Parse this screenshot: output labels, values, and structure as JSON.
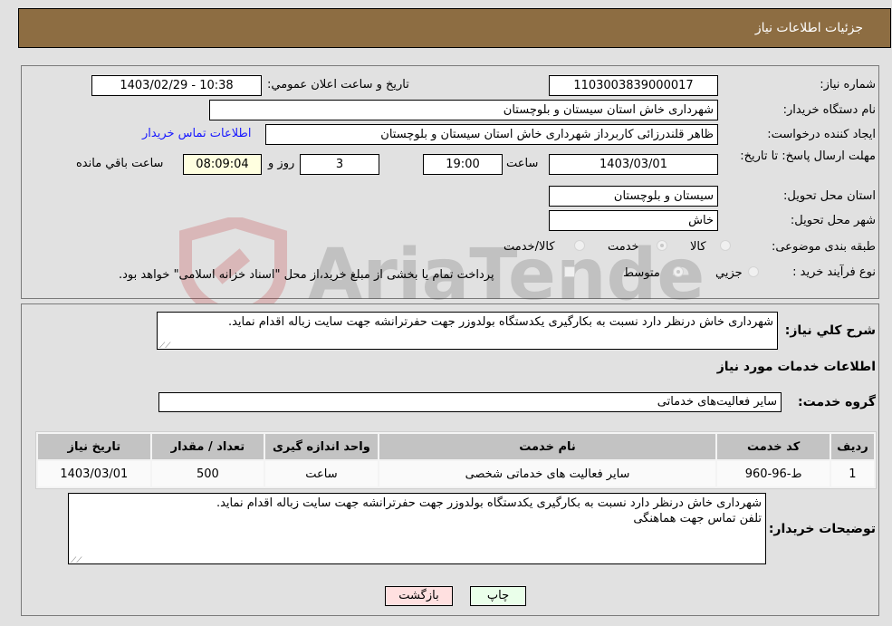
{
  "header": {
    "title": "جزئیات اطلاعات نیاز"
  },
  "details": {
    "need_number": {
      "label": "شماره نیاز:",
      "value": "1103003839000017"
    },
    "announce_datetime": {
      "label": "تاریخ و ساعت اعلان عمومي:",
      "value": "1403/02/29 - 10:38"
    },
    "buyer_org": {
      "label": "نام دستگاه خریدار:",
      "value": "شهرداری خاش استان سیستان و بلوچستان"
    },
    "requester": {
      "label": "ایجاد کننده درخواست:",
      "value": "ظاهر قلندرزائی کاربرداز شهرداری خاش استان سیستان و بلوچستان"
    },
    "buyer_contact_link": "اطلاعات تماس خریدار",
    "deadline": {
      "label": "مهلت ارسال پاسخ: تا تاریخ:",
      "date": "1403/03/01",
      "time_label": "ساعت",
      "time": "19:00",
      "days": "3",
      "days_label": "روز و",
      "remaining": "08:09:04",
      "remaining_label": "ساعت باقي مانده"
    },
    "delivery_province": {
      "label": "استان محل تحویل:",
      "value": "سیستان و بلوچستان"
    },
    "delivery_city": {
      "label": "شهر محل تحویل:",
      "value": "خاش"
    },
    "category": {
      "label": "طبقه بندی موضوعی:",
      "options": [
        "کالا",
        "خدمت",
        "کالا/خدمت"
      ],
      "selected": "خدمت"
    },
    "purchase_type": {
      "label": "نوع فرآیند خرید :",
      "options": [
        "جزیي",
        "متوسط"
      ],
      "selected": "متوسط",
      "treasury_note": "پرداخت تمام یا بخشی از مبلغ خرید،از محل \"اسناد خزانه اسلامی\" خواهد بود."
    }
  },
  "summary": {
    "label": "شرح کلي نیاز:",
    "value": "شهرداری خاش درنظر دارد نسبت به بکارگیری یکدستگاه بولدوزر جهت حفرترانشه جهت سایت زباله اقدام نماید."
  },
  "services": {
    "section_title": "اطلاعات خدمات مورد نیاز",
    "group_label": "گروه خدمت:",
    "group_value": "سایر فعالیت‌های خدماتی",
    "table": {
      "headers": [
        "ردیف",
        "کد خدمت",
        "نام خدمت",
        "واحد اندازه گیری",
        "تعداد / مقدار",
        "تاریخ نیاز"
      ],
      "rows": [
        [
          "1",
          "ط-96-960",
          "سایر فعالیت های خدماتی شخصی",
          "ساعت",
          "500",
          "1403/03/01"
        ]
      ]
    }
  },
  "buyer_notes": {
    "label": "توضیحات خریدار:",
    "line1": "شهرداری خاش درنظر دارد نسبت به بکارگیری یکدستگاه بولدوزر جهت حفرترانشه جهت سایت زباله اقدام نماید.",
    "line2": "تلفن تماس جهت هماهنگی"
  },
  "buttons": {
    "print": "چاپ",
    "back": "بازگشت"
  },
  "colors": {
    "header_bg": "#8d6d42",
    "print_bg": "#eaffea",
    "back_bg": "#ffe0e0",
    "link": "#1a1aff"
  }
}
